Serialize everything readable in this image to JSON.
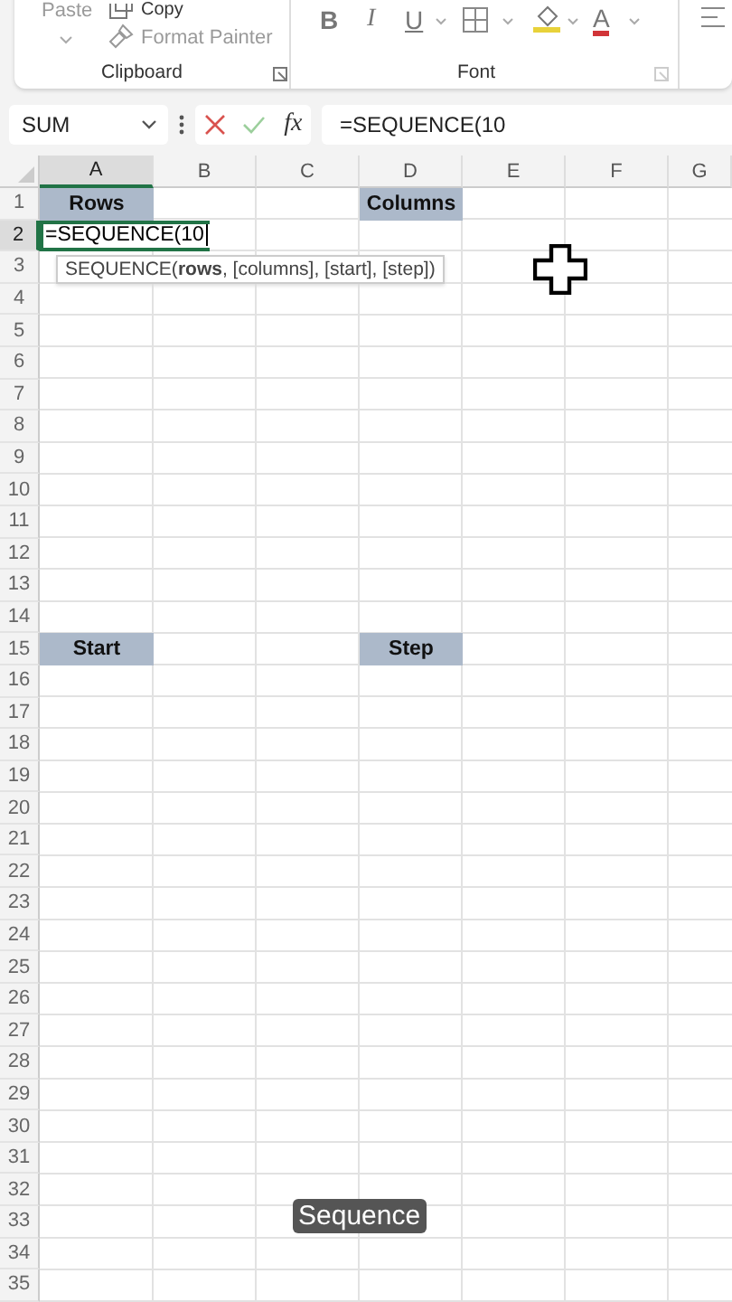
{
  "ribbon": {
    "clipboard": {
      "paste": "Paste",
      "copy": "Copy",
      "format_painter": "Format Painter",
      "label": "Clipboard"
    },
    "font": {
      "bold": "B",
      "italic": "I",
      "underline": "U",
      "font_color": "A",
      "label": "Font"
    }
  },
  "formula_bar": {
    "name_box": "SUM",
    "fx": "fx",
    "formula": "=SEQUENCE(10"
  },
  "sheet": {
    "columns": [
      {
        "label": "A",
        "selected": true
      },
      {
        "label": "B",
        "selected": false
      },
      {
        "label": "C",
        "selected": false
      },
      {
        "label": "D",
        "selected": false
      },
      {
        "label": "E",
        "selected": false
      },
      {
        "label": "F",
        "selected": false
      },
      {
        "label": "G",
        "selected": false
      }
    ],
    "rows": [
      {
        "label": "1",
        "selected": false,
        "cells": {
          "A": {
            "text": "Rows",
            "kind": "heading"
          },
          "D": {
            "text": "Columns",
            "kind": "heading"
          }
        }
      },
      {
        "label": "2",
        "selected": true,
        "cells": {
          "A": {
            "text": "=SEQUENCE(10",
            "kind": "editing"
          }
        }
      },
      {
        "label": "3",
        "selected": false
      },
      {
        "label": "4",
        "selected": false
      },
      {
        "label": "5",
        "selected": false
      },
      {
        "label": "6",
        "selected": false
      },
      {
        "label": "7",
        "selected": false
      },
      {
        "label": "8",
        "selected": false
      },
      {
        "label": "9",
        "selected": false
      },
      {
        "label": "10",
        "selected": false
      },
      {
        "label": "11",
        "selected": false
      },
      {
        "label": "12",
        "selected": false
      },
      {
        "label": "13",
        "selected": false
      },
      {
        "label": "14",
        "selected": false
      },
      {
        "label": "15",
        "selected": false,
        "cells": {
          "A": {
            "text": "Start",
            "kind": "heading"
          },
          "D": {
            "text": "Step",
            "kind": "heading"
          }
        }
      },
      {
        "label": "16",
        "selected": false
      },
      {
        "label": "17",
        "selected": false
      },
      {
        "label": "18",
        "selected": false
      },
      {
        "label": "19",
        "selected": false
      },
      {
        "label": "20",
        "selected": false
      },
      {
        "label": "21",
        "selected": false
      },
      {
        "label": "22",
        "selected": false
      },
      {
        "label": "23",
        "selected": false
      },
      {
        "label": "24",
        "selected": false
      },
      {
        "label": "25",
        "selected": false
      },
      {
        "label": "26",
        "selected": false
      },
      {
        "label": "27",
        "selected": false
      },
      {
        "label": "28",
        "selected": false
      },
      {
        "label": "29",
        "selected": false
      },
      {
        "label": "30",
        "selected": false
      },
      {
        "label": "31",
        "selected": false
      },
      {
        "label": "32",
        "selected": false
      },
      {
        "label": "33",
        "selected": false
      },
      {
        "label": "34",
        "selected": false
      },
      {
        "label": "35",
        "selected": false
      }
    ],
    "tooltip": "SEQUENCE(**rows**, [columns], [start], [step])"
  },
  "caption": "Sequence"
}
